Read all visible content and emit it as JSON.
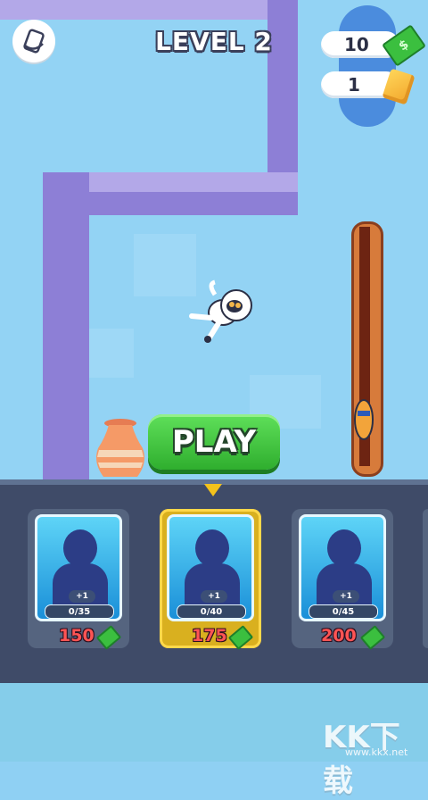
{
  "hud": {
    "level_label": "LEVEL 2",
    "cash": "10",
    "gold": "1"
  },
  "play": {
    "label": "PLAY"
  },
  "shop": {
    "cards": [
      {
        "plus": "+1",
        "progress": "0/35",
        "price": "150",
        "selected": false
      },
      {
        "plus": "+1",
        "progress": "0/40",
        "price": "175",
        "selected": true
      },
      {
        "plus": "+1",
        "progress": "0/45",
        "price": "200",
        "selected": false
      }
    ]
  },
  "watermark": {
    "text": "KK下载",
    "url": "www.kkx.net"
  },
  "colors": {
    "accent_green": "#3bbf3f",
    "price_red": "#ff5454",
    "panel": "#3f4b68",
    "selected_gold": "#d9b01f"
  },
  "icons": [
    "settings-icon",
    "cash-icon",
    "gold-bar-icon",
    "cash-mini-icon"
  ]
}
